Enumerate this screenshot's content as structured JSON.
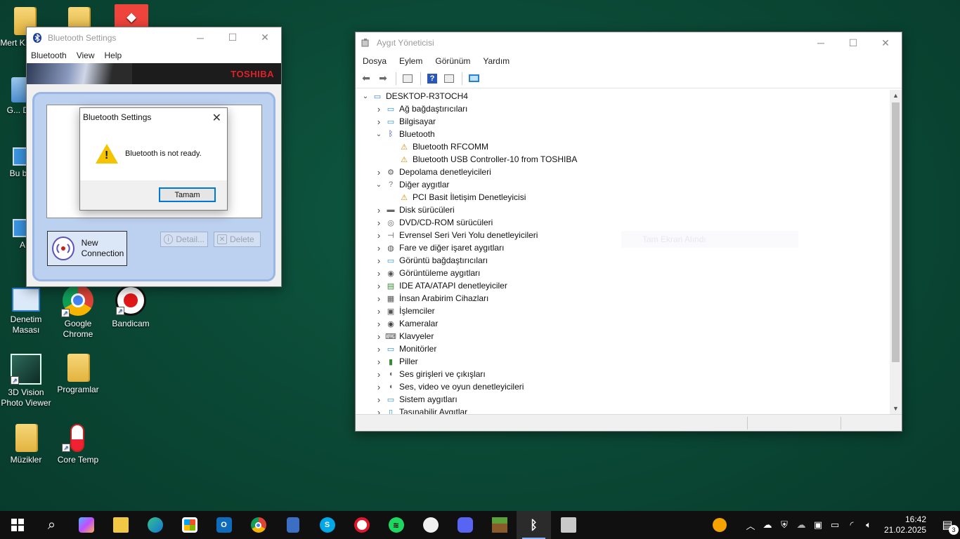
{
  "desktop": {
    "icons": [
      {
        "label": "Mert K... Ka..."
      },
      {
        "label": "G... Dön..."
      },
      {
        "label": "Bu bilg..."
      },
      {
        "label": "A..."
      },
      {
        "label": "Denetim Masası"
      },
      {
        "label": "Google Chrome"
      },
      {
        "label": "Bandicam"
      },
      {
        "label": "3D Vision Photo Viewer"
      },
      {
        "label": "Programlar"
      },
      {
        "label": "Müzikler"
      },
      {
        "label": "Core Temp"
      }
    ]
  },
  "bt_window": {
    "title": "Bluetooth Settings",
    "menu": [
      "Bluetooth",
      "View",
      "Help"
    ],
    "brand": "TOSHIBA",
    "new_connection": "New Connection",
    "details": "Detail...",
    "delete": "Delete"
  },
  "bt_dialog": {
    "title": "Bluetooth Settings",
    "message": "Bluetooth is not ready.",
    "ok": "Tamam",
    "icon": "warning-icon"
  },
  "device_manager": {
    "title": "Aygıt Yöneticisi",
    "menu": [
      "Dosya",
      "Eylem",
      "Görünüm",
      "Yardım"
    ],
    "ghost_text": "Tam Ekran Alındı",
    "tree": [
      {
        "label": "DESKTOP-R3TOCH4",
        "level": 0,
        "exp": "open",
        "icon": "computer-icon"
      },
      {
        "label": "Ağ bağdaştırıcıları",
        "level": 1,
        "exp": "closed",
        "icon": "network-icon"
      },
      {
        "label": "Bilgisayar",
        "level": 1,
        "exp": "closed",
        "icon": "monitor-icon"
      },
      {
        "label": "Bluetooth",
        "level": 1,
        "exp": "open",
        "icon": "bluetooth-icon"
      },
      {
        "label": "Bluetooth RFCOMM",
        "level": 2,
        "exp": "none",
        "icon": "warning-icon"
      },
      {
        "label": "Bluetooth USB Controller-10 from TOSHIBA",
        "level": 2,
        "exp": "none",
        "icon": "warning-icon"
      },
      {
        "label": "Depolama denetleyicileri",
        "level": 1,
        "exp": "closed",
        "icon": "storage-icon"
      },
      {
        "label": "Diğer aygıtlar",
        "level": 1,
        "exp": "open",
        "icon": "unknown-device-icon"
      },
      {
        "label": "PCI Basit İletişim Denetleyicisi",
        "level": 2,
        "exp": "none",
        "icon": "warning-icon"
      },
      {
        "label": "Disk sürücüleri",
        "level": 1,
        "exp": "closed",
        "icon": "disk-icon"
      },
      {
        "label": "DVD/CD-ROM sürücüleri",
        "level": 1,
        "exp": "closed",
        "icon": "dvd-icon"
      },
      {
        "label": "Evrensel Seri Veri Yolu denetleyicileri",
        "level": 1,
        "exp": "closed",
        "icon": "usb-icon"
      },
      {
        "label": "Fare ve diğer işaret aygıtları",
        "level": 1,
        "exp": "closed",
        "icon": "mouse-icon"
      },
      {
        "label": "Görüntü bağdaştırıcıları",
        "level": 1,
        "exp": "closed",
        "icon": "display-adapter-icon"
      },
      {
        "label": "Görüntüleme aygıtları",
        "level": 1,
        "exp": "closed",
        "icon": "imaging-icon"
      },
      {
        "label": "IDE ATA/ATAPI denetleyiciler",
        "level": 1,
        "exp": "closed",
        "icon": "ide-icon"
      },
      {
        "label": "İnsan Arabirim Cihazları",
        "level": 1,
        "exp": "closed",
        "icon": "hid-icon"
      },
      {
        "label": "İşlemciler",
        "level": 1,
        "exp": "closed",
        "icon": "cpu-icon"
      },
      {
        "label": "Kameralar",
        "level": 1,
        "exp": "closed",
        "icon": "camera-icon"
      },
      {
        "label": "Klavyeler",
        "level": 1,
        "exp": "closed",
        "icon": "keyboard-icon"
      },
      {
        "label": "Monitörler",
        "level": 1,
        "exp": "closed",
        "icon": "monitor-icon"
      },
      {
        "label": "Piller",
        "level": 1,
        "exp": "closed",
        "icon": "battery-icon"
      },
      {
        "label": "Ses girişleri ve çıkışları",
        "level": 1,
        "exp": "closed",
        "icon": "speaker-icon"
      },
      {
        "label": "Ses, video ve oyun denetleyicileri",
        "level": 1,
        "exp": "closed",
        "icon": "speaker-icon"
      },
      {
        "label": "Sistem aygıtları",
        "level": 1,
        "exp": "closed",
        "icon": "system-icon"
      },
      {
        "label": "Taşınabilir Aygıtlar",
        "level": 1,
        "exp": "closed",
        "icon": "portable-icon"
      }
    ]
  },
  "taskbar": {
    "apps": [
      "start-icon",
      "search-icon",
      "copilot-icon",
      "file-explorer-icon",
      "edge-icon",
      "store-icon",
      "outlook-icon",
      "chrome-icon",
      "calculator-icon",
      "skype-icon",
      "opera-icon",
      "spotify-icon",
      "paint-icon",
      "discord-icon",
      "minecraft-icon",
      "bluetooth-icon",
      "device-manager-icon"
    ],
    "time": "16:42",
    "date": "21.02.2025",
    "notification_count": "3"
  },
  "colors": {
    "desktop": "#0b4a36",
    "taskbar": "#101010",
    "accent": "#0078d7",
    "warning": "#f5c400",
    "toshiba_red": "#e0202a"
  }
}
